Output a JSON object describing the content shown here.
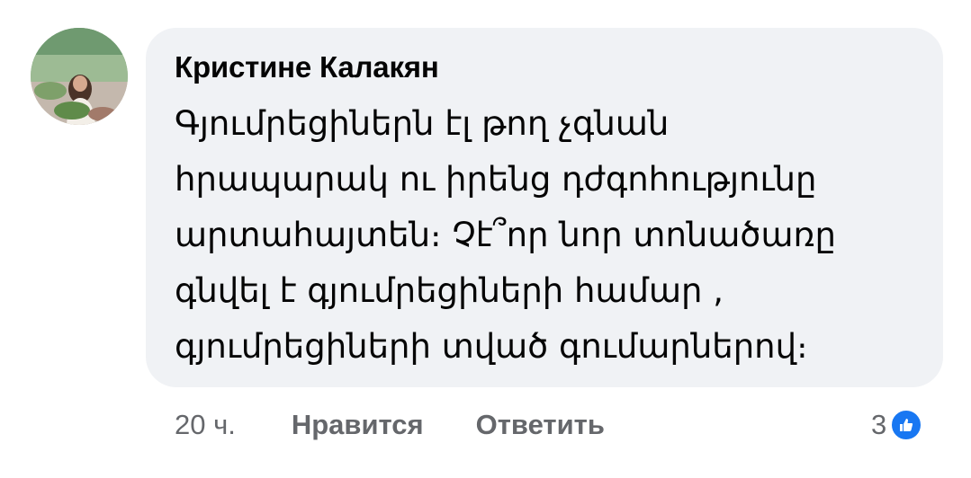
{
  "comment": {
    "author": "Кристине Калакян",
    "lines": [
      "Գյումրեցիներն էլ թող չգնան",
      "հրապարակ ու իրենց դժգոհությունը",
      "արտահայտեն։ Չէ՞որ նոր տոնածառը",
      "գնվել է գյումրեցիների համար ,",
      "գյումրեցիների  տված գումարներով։"
    ]
  },
  "actions": {
    "time": "20 ч.",
    "like_label": "Нравится",
    "reply_label": "Ответить"
  },
  "reactions": {
    "count": "3",
    "icon": "thumbs-up-icon",
    "color": "#1877f2"
  }
}
